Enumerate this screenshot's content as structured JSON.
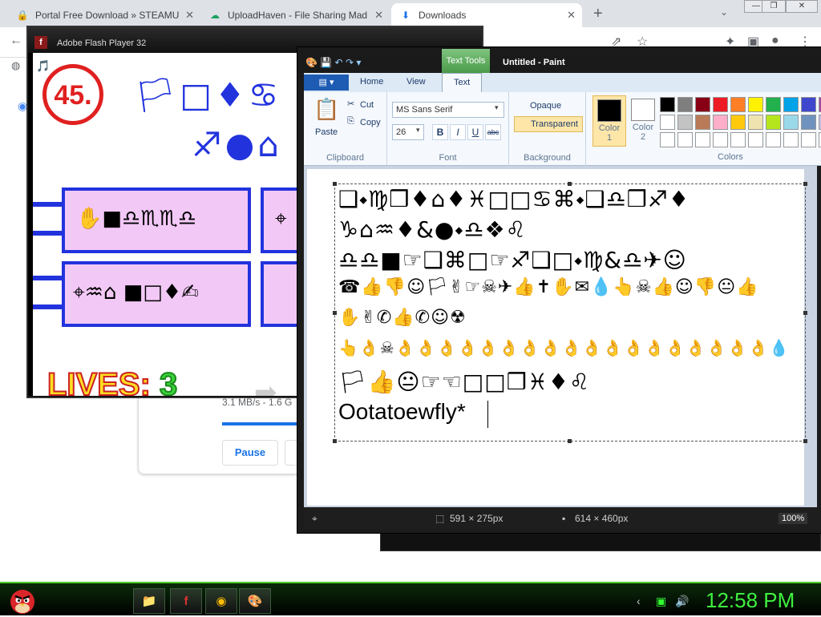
{
  "browser": {
    "tabs": [
      {
        "label": "Portal Free Download » STEAMU",
        "icon": "red-lock-icon",
        "active": false
      },
      {
        "label": "UploadHaven - File Sharing Mad",
        "icon": "uploadhaven-icon",
        "active": false
      },
      {
        "label": "Downloads",
        "icon": "download-icon",
        "active": true
      }
    ],
    "new_tab": "+",
    "close_glyph": "✕"
  },
  "downloads_page": {
    "speed_text": "3.1 MB/s - 1.6 G",
    "pause_label": "Pause"
  },
  "flash": {
    "title": "Adobe Flash Player 32",
    "score": "45.",
    "lives_label": "LIVES:",
    "lives_value": "3",
    "row1": "🏳□♦♋",
    "row2": "♐●⌂",
    "box1": "✋■♎♏♏♎",
    "box2": "⌖",
    "box3": "⌖♒⌂    ■□♦✍",
    "colors": {
      "blue": "#2233dd",
      "pink": "#f2c8f6",
      "red": "#e02020"
    }
  },
  "paint": {
    "title": "Untitled - Paint",
    "contextual_tab": "Text Tools",
    "ribbon_tabs": [
      "Home",
      "View",
      "Text"
    ],
    "active_tab": "Text",
    "clipboard": {
      "paste": "Paste",
      "cut": "Cut",
      "copy": "Copy",
      "group": "Clipboard"
    },
    "font": {
      "family": "MS Sans Serif",
      "size": "26",
      "bold": "B",
      "italic": "I",
      "underline": "U",
      "strike": "abc",
      "group": "Font"
    },
    "background": {
      "opaque": "Opaque",
      "transparent": "Transparent",
      "group": "Background"
    },
    "colors": {
      "color1": "Color\n1",
      "color1_label": "Color",
      "color1_num": "1",
      "color2_label": "Color",
      "color2_num": "2",
      "group": "Colors",
      "color1_value": "#000000",
      "color2_value": "#ffffff"
    },
    "palette": [
      "#000000",
      "#7f7f7f",
      "#880015",
      "#ed1c24",
      "#ff7f27",
      "#fff200",
      "#22b14c",
      "#00a2e8",
      "#3f48cc",
      "#a349a4",
      "#ffffff",
      "#c3c3c3",
      "#b97a57",
      "#ffaec9",
      "#ffc90e",
      "#efe4b0",
      "#b5e61d",
      "#99d9ea",
      "#7092be",
      "#c8bfe7",
      "#ffffff",
      "#ffffff",
      "#ffffff",
      "#ffffff",
      "#ffffff",
      "#ffffff",
      "#ffffff",
      "#ffffff",
      "#ffffff",
      "#ffffff"
    ],
    "text_lines": [
      "❑⬩♍❒♦⌂♦♓□□♋⌘⬩❑♎❒♐♦",
      "♑⌂♒♦&●⬩♎❖♌",
      "♎♎■☞❑⌘□☞♐❑□⬩♍&♎✈☺",
      "☎👍👎☺🏳✌☞☠✈👍✝✋✉💧👆☠👍☺👎😐👍",
      "✋✌✆👍✆☺☢",
      "👆👌☠👌👌👌👌👌👌👌👌👌👌👌👌👌👌👌👌👌👌💧",
      "🏳👍😐☞☜□□❒♓♦♌"
    ],
    "typed_text": "Ootatoewfly*",
    "status_selection": "591 × 275px",
    "status_canvas": "614 × 460px",
    "zoom": "100%"
  },
  "taskbar": {
    "clock": "12:58 PM"
  }
}
